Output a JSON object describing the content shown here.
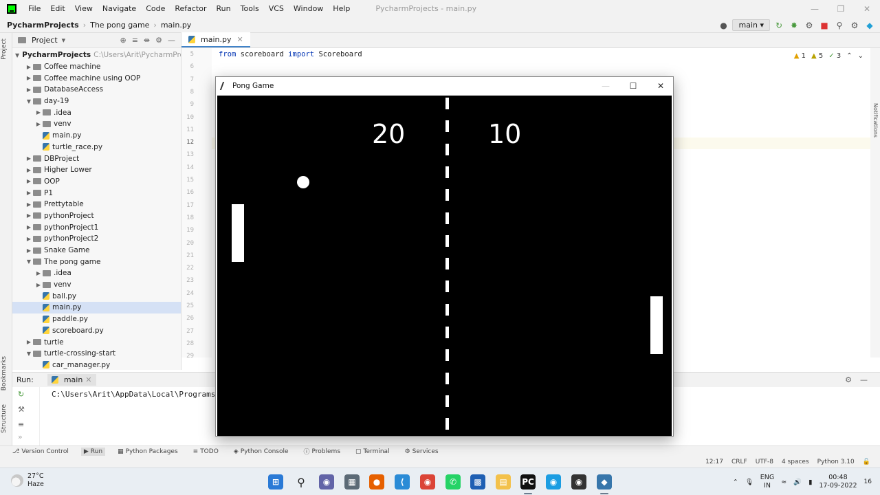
{
  "menubar": {
    "items": [
      "File",
      "Edit",
      "View",
      "Navigate",
      "Code",
      "Refactor",
      "Run",
      "Tools",
      "VCS",
      "Window",
      "Help"
    ],
    "window_title": "PycharmProjects - main.py",
    "minimize_icon": "minimize-icon",
    "maximize_icon": "maximize-icon",
    "close_icon": "close-icon"
  },
  "navbar": {
    "crumbs": [
      "PycharmProjects",
      "The pong game",
      "main.py"
    ],
    "branch": "main"
  },
  "project_panel": {
    "title": "Project",
    "root_label": "PycharmProjects",
    "root_path": "C:\\Users\\Arit\\PycharmProjects",
    "items": [
      {
        "label": "Coffee machine",
        "type": "folder",
        "depth": 1,
        "expanded": false
      },
      {
        "label": "Coffee machine using OOP",
        "type": "folder",
        "depth": 1,
        "expanded": false
      },
      {
        "label": "DatabaseAccess",
        "type": "folder",
        "depth": 1,
        "expanded": false
      },
      {
        "label": "day-19",
        "type": "folder",
        "depth": 1,
        "expanded": true
      },
      {
        "label": ".idea",
        "type": "folder",
        "depth": 2,
        "expanded": false
      },
      {
        "label": "venv",
        "type": "folder",
        "depth": 2,
        "expanded": false
      },
      {
        "label": "main.py",
        "type": "file",
        "depth": 2
      },
      {
        "label": "turtle_race.py",
        "type": "file",
        "depth": 2
      },
      {
        "label": "DBProject",
        "type": "folder",
        "depth": 1,
        "expanded": false
      },
      {
        "label": "Higher Lower",
        "type": "folder",
        "depth": 1,
        "expanded": false
      },
      {
        "label": "OOP",
        "type": "folder",
        "depth": 1,
        "expanded": false
      },
      {
        "label": "P1",
        "type": "folder",
        "depth": 1,
        "expanded": false
      },
      {
        "label": "Prettytable",
        "type": "folder",
        "depth": 1,
        "expanded": false
      },
      {
        "label": "pythonProject",
        "type": "folder",
        "depth": 1,
        "expanded": false
      },
      {
        "label": "pythonProject1",
        "type": "folder",
        "depth": 1,
        "expanded": false
      },
      {
        "label": "pythonProject2",
        "type": "folder",
        "depth": 1,
        "expanded": false
      },
      {
        "label": "Snake Game",
        "type": "folder",
        "depth": 1,
        "expanded": false
      },
      {
        "label": "The pong game",
        "type": "folder",
        "depth": 1,
        "expanded": true
      },
      {
        "label": ".idea",
        "type": "folder",
        "depth": 2,
        "expanded": false
      },
      {
        "label": "venv",
        "type": "folder",
        "depth": 2,
        "expanded": false
      },
      {
        "label": "ball.py",
        "type": "file",
        "depth": 2
      },
      {
        "label": "main.py",
        "type": "file",
        "depth": 2,
        "selected": true
      },
      {
        "label": "paddle.py",
        "type": "file",
        "depth": 2
      },
      {
        "label": "scoreboard.py",
        "type": "file",
        "depth": 2
      },
      {
        "label": "turtle",
        "type": "folder",
        "depth": 1,
        "expanded": false
      },
      {
        "label": "turtle-crossing-start",
        "type": "folder",
        "depth": 1,
        "expanded": true
      },
      {
        "label": "car_manager.py",
        "type": "file",
        "depth": 2
      }
    ]
  },
  "editor": {
    "tab_label": "main.py",
    "line_numbers": [
      "5",
      "6",
      "7",
      "8",
      "9",
      "10",
      "11",
      "12",
      "13",
      "14",
      "15",
      "16",
      "17",
      "18",
      "19",
      "20",
      "21",
      "22",
      "23",
      "24",
      "25",
      "26",
      "27",
      "28",
      "29"
    ],
    "current_line": "12",
    "code": {
      "keyword1": "from",
      "module": "scoreboard",
      "keyword2": "import",
      "name": "Scoreboard"
    },
    "inspections": {
      "warnings": "1",
      "weak_warnings": "5",
      "typos": "3"
    }
  },
  "run_panel": {
    "label": "Run:",
    "config": "main",
    "output": "C:\\Users\\Arit\\AppData\\Local\\Programs"
  },
  "tool_windows": [
    "Version Control",
    "Run",
    "Python Packages",
    "TODO",
    "Python Console",
    "Problems",
    "Terminal",
    "Services"
  ],
  "status_bar": [
    "12:17",
    "CRLF",
    "UTF-8",
    "4 spaces",
    "Python 3.10"
  ],
  "side_labels": {
    "project": "Project",
    "bookmarks": "Bookmarks",
    "structure": "Structure",
    "notifications": "Notifications"
  },
  "pong": {
    "title": "Pong Game",
    "left_score": 20,
    "right_score": 10,
    "colors": {
      "background": "#000000",
      "foreground": "#ffffff"
    }
  },
  "taskbar": {
    "temperature": "27°C",
    "weather": "Haze",
    "lang_top": "ENG",
    "lang_bottom": "IN",
    "time": "00:48",
    "date": "17-09-2022",
    "notification_count": "16"
  }
}
